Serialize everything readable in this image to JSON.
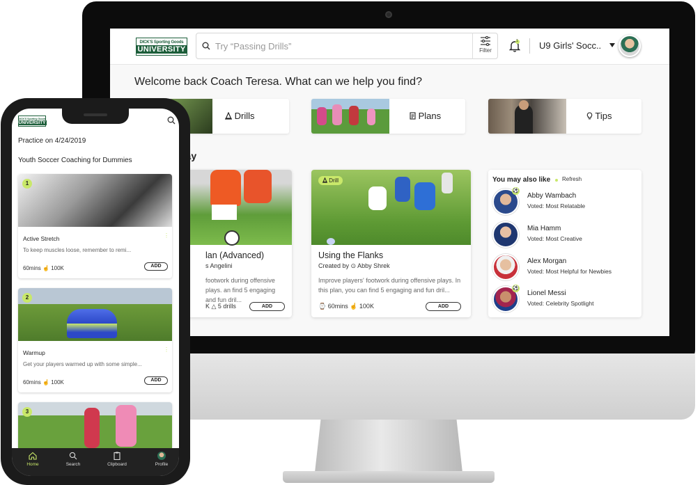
{
  "desktop": {
    "logo": {
      "brand": "DICK'S Sporting Goods",
      "name": "UNIVERSITY"
    },
    "search": {
      "placeholder": "Try “Passing Drills”"
    },
    "filter_label": "Filter",
    "notification_count": "1",
    "team_selector": "U9 Girls' Socc..",
    "welcome": "Welcome back Coach Teresa. What can we help you find?",
    "categories": [
      {
        "label": "Drills",
        "icon": "cone-icon"
      },
      {
        "label": "Plans",
        "icon": "document-icon"
      },
      {
        "label": "Tips",
        "icon": "lightbulb-icon"
      }
    ],
    "section_title": "day",
    "cards": [
      {
        "title": "lan (Advanced)",
        "by": "s Angelini",
        "desc": "footwork during offensive plays. an find 5 engaging and fun dril...",
        "meta": "K  △ 5 drills",
        "add": "ADD"
      },
      {
        "badge": "Drill",
        "title": "Using the Flanks",
        "by": "Created by ⊙ Abby Shrek",
        "desc": "Improve players' footwork during offensive plays. In this plan, you can find 5 engaging and fun dril...",
        "meta": "⌚ 60mins  ☝ 100K",
        "add": "ADD"
      }
    ],
    "also_like": {
      "title": "You may also like",
      "refresh": "Refresh",
      "people": [
        {
          "name": "Abby Wambach",
          "voted": "Voted: Most Relatable"
        },
        {
          "name": "Mia Hamm",
          "voted": "Voted: Most Creative"
        },
        {
          "name": "Alex Morgan",
          "voted": "Voted: Most Helpful for Newbies"
        },
        {
          "name": "Lionel Messi",
          "voted": "Voted: Celebrity Spotlight"
        }
      ]
    }
  },
  "mobile": {
    "logo": {
      "brand": "DICK'S Sporting Goods",
      "name": "UNIVERSITY"
    },
    "practice": "Practice on 4/24/2019",
    "plan_title": "Youth Soccer Coaching for Dummies",
    "items": [
      {
        "num": "1",
        "title": "Active Stretch",
        "desc": "To keep muscles loose, remember to remi...",
        "meta": "60mins  ☝ 100K",
        "add": "ADD"
      },
      {
        "num": "2",
        "title": "Warmup",
        "desc": "Get your players warmed up with some simple...",
        "meta": "60mins  ☝ 100K",
        "add": "ADD"
      },
      {
        "num": "3"
      }
    ],
    "tabs": [
      {
        "label": "Home",
        "icon": "home-icon",
        "active": true
      },
      {
        "label": "Search",
        "icon": "search-icon"
      },
      {
        "label": "Clipboard",
        "icon": "clipboard-icon"
      },
      {
        "label": "Profile",
        "icon": "profile-avatar-icon"
      }
    ]
  },
  "colors": {
    "accent": "#c9e86a",
    "brand_green": "#1c5e3a",
    "tabbar": "#222222"
  }
}
